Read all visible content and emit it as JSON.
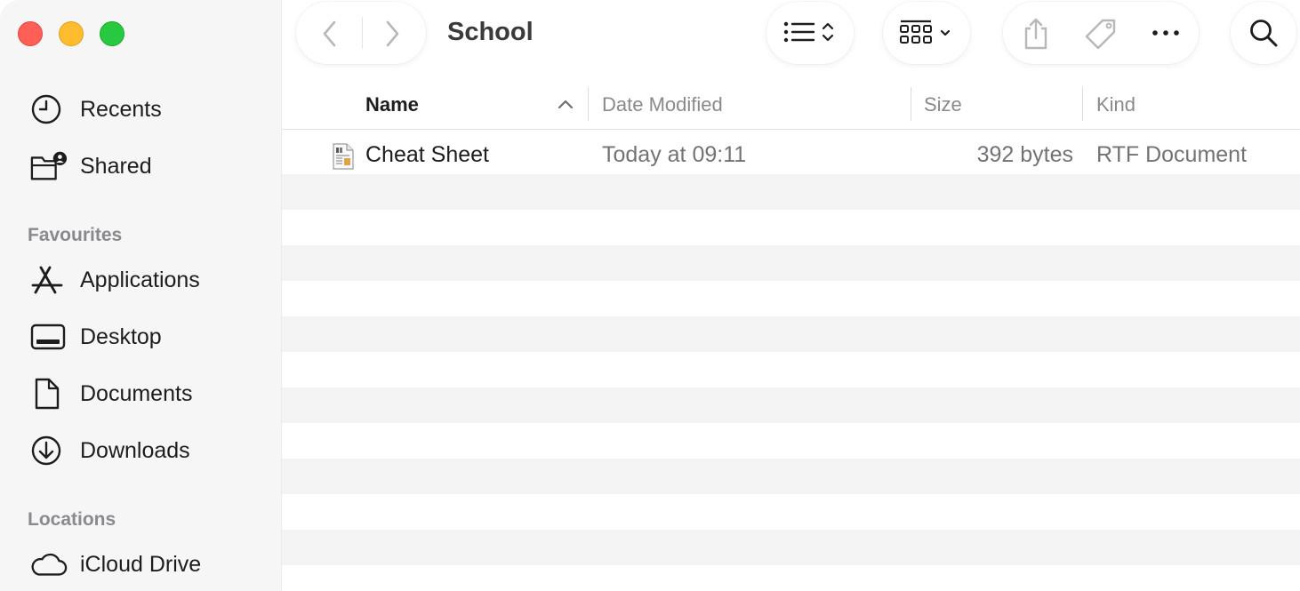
{
  "window": {
    "title": "School"
  },
  "sidebar": {
    "top_items": [
      {
        "label": "Recents",
        "icon": "clock-icon"
      },
      {
        "label": "Shared",
        "icon": "shared-folder-icon"
      }
    ],
    "favourites_header": "Favourites",
    "favourites": [
      {
        "label": "Applications",
        "icon": "applications-icon"
      },
      {
        "label": "Desktop",
        "icon": "desktop-icon"
      },
      {
        "label": "Documents",
        "icon": "document-icon"
      },
      {
        "label": "Downloads",
        "icon": "download-icon"
      }
    ],
    "locations_header": "Locations",
    "locations": [
      {
        "label": "iCloud Drive",
        "icon": "cloud-icon"
      }
    ]
  },
  "columns": {
    "name": "Name",
    "date_modified": "Date Modified",
    "size": "Size",
    "kind": "Kind",
    "sort_column": "Name",
    "sort_direction": "ascending"
  },
  "files": [
    {
      "name": "Cheat Sheet",
      "date_modified": "Today at 09:11",
      "size": "392 bytes",
      "kind": "RTF Document",
      "icon": "rtf-document-icon"
    }
  ],
  "colors": {
    "close": "#ff5f57",
    "minimize": "#febc2e",
    "zoom": "#28c840",
    "sidebar_bg": "#f6f6f6",
    "row_alt": "#f4f4f4"
  }
}
